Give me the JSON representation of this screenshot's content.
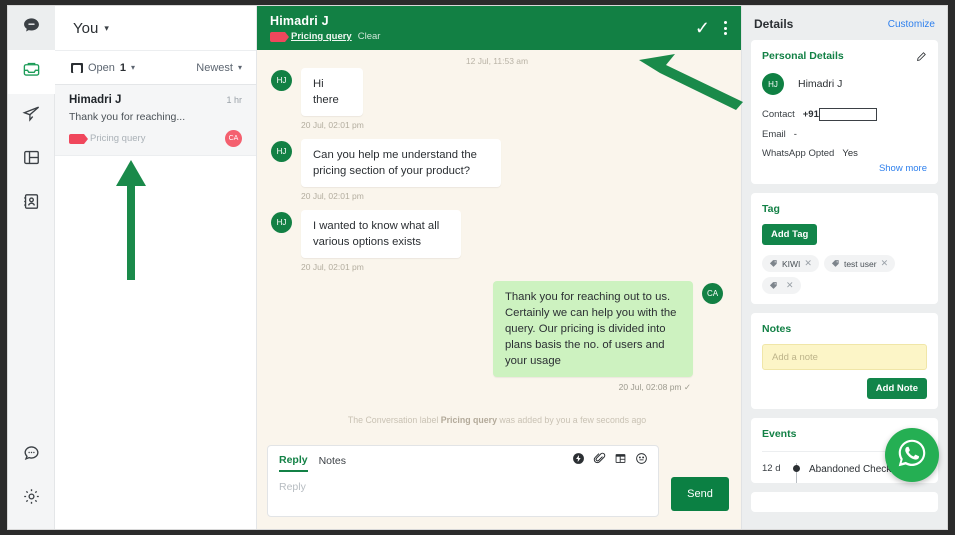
{
  "rail": {
    "items": [
      {
        "name": "logo-icon",
        "label": "Logo"
      },
      {
        "name": "inbox-icon",
        "label": "Inbox"
      },
      {
        "name": "broadcast-icon",
        "label": "Broadcast"
      },
      {
        "name": "dashboard-icon",
        "label": "Dashboard"
      },
      {
        "name": "contacts-icon",
        "label": "Contacts"
      }
    ],
    "bottom": [
      {
        "name": "chat-support-icon",
        "label": "Support"
      },
      {
        "name": "settings-gear-icon",
        "label": "Settings"
      }
    ]
  },
  "conversation_list": {
    "header": {
      "assignee": "You",
      "caret": "▾"
    },
    "filters": {
      "status": "Open",
      "count": "1",
      "status_caret": "▾",
      "sort": "Newest",
      "sort_caret": "▾"
    },
    "items": [
      {
        "name": "Himadri J",
        "time": "1 hr",
        "snippet": "Thank you for reaching...",
        "label": "Pricing query",
        "avatar_initials": "CA"
      }
    ]
  },
  "chat": {
    "header": {
      "title": "Himadri J",
      "label": "Pricing query",
      "clear": "Clear",
      "resolve_icon": "✓"
    },
    "daystamp": "12 Jul, 11:53 am",
    "messages": [
      {
        "direction": "in",
        "avatar": "HJ",
        "text": "Hi there",
        "time": "20 Jul, 02:01 pm"
      },
      {
        "direction": "in",
        "avatar": "HJ",
        "text": "Can you help me understand the pricing section of your product?",
        "time": "20 Jul, 02:01 pm"
      },
      {
        "direction": "in",
        "avatar": "HJ",
        "text": "I wanted to know what all various options exists",
        "time": "20 Jul, 02:01 pm"
      },
      {
        "direction": "out",
        "avatar": "CA",
        "text": "Thank you for reaching out to us. Certainly we can help you with the query. Our pricing is divided into plans basis the no. of users and your usage",
        "time": "20 Jul, 02:08 pm ✓"
      }
    ],
    "system_message": {
      "prefix": "The Conversation label ",
      "bold": "Pricing query",
      "suffix": " was added by you a few seconds ago"
    },
    "composer": {
      "tab_reply": "Reply",
      "tab_notes": "Notes",
      "placeholder": "Reply",
      "send_label": "Send"
    }
  },
  "details": {
    "title": "Details",
    "customize": "Customize",
    "personal": {
      "title": "Personal Details",
      "avatar_initials": "HJ",
      "name": "Himadri J",
      "contact_key": "Contact",
      "contact_prefix": "+91",
      "contact_value": "",
      "email_key": "Email",
      "email_value": "-",
      "whatsapp_key": "WhatsApp Opted",
      "whatsapp_value": "Yes",
      "show_more": "Show more"
    },
    "tag": {
      "title": "Tag",
      "add_label": "Add Tag",
      "tags": [
        "KIWI",
        "test user",
        ""
      ]
    },
    "notes": {
      "title": "Notes",
      "placeholder": "Add a note",
      "add_label": "Add Note"
    },
    "events": {
      "title": "Events",
      "rows": [
        {
          "age": "12 d",
          "name": "Abandoned Checkout",
          "chevron": "›"
        }
      ]
    }
  },
  "colors": {
    "brand_green": "#128044",
    "accent_link": "#2f80ed",
    "label_red": "#f0475c",
    "outgoing_bubble": "#cdf2c0",
    "chat_bg": "#faf5ec",
    "whatsapp_green": "#25af53",
    "annotation_green": "#1a8a4a"
  },
  "floating_action": {
    "name": "whatsapp-fab",
    "label": "WhatsApp"
  }
}
